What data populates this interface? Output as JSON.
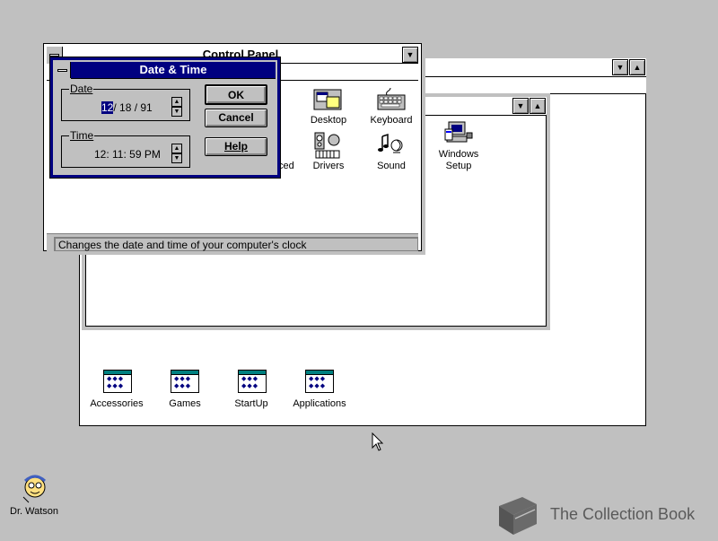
{
  "control_panel": {
    "title": "Control Panel",
    "icons": [
      {
        "label": "Desktop",
        "icon": "desktop-icon"
      },
      {
        "label": "Keyboard",
        "icon": "keyboard-icon"
      },
      {
        "label": "Drivers",
        "icon": "drivers-icon"
      },
      {
        "label": "Sound",
        "icon": "sound-icon"
      }
    ],
    "partial_label": "ced",
    "status": "Changes the date and time of your computer's clock"
  },
  "date_time_dialog": {
    "title": "Date & Time",
    "date_group_label": "Date",
    "date_month": "12",
    "date_rest": "/ 18 / 91",
    "time_group_label": "Time",
    "time_value": "12: 11: 59 PM",
    "ok_label": "OK",
    "cancel_label": "Cancel",
    "help_label": "Help"
  },
  "main_group": {
    "setup_label": "Windows\nSetup"
  },
  "program_groups": [
    {
      "label": "Accessories"
    },
    {
      "label": "Games"
    },
    {
      "label": "StartUp"
    },
    {
      "label": "Applications"
    }
  ],
  "desktop": {
    "dr_watson_label": "Dr. Watson",
    "watermark": "The Collection Book"
  }
}
